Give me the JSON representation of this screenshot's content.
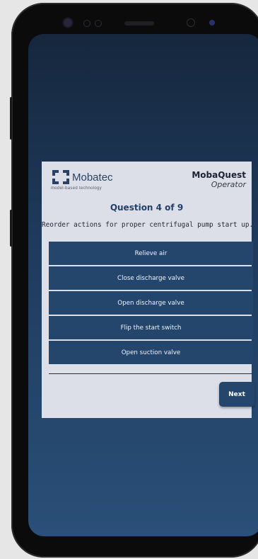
{
  "app": {
    "logo_name": "Mobatec",
    "logo_tagline": "model-based technology",
    "brand_title": "MobaQuest",
    "brand_subtitle": "Operator"
  },
  "question": {
    "number_label": "Question 4 of 9",
    "prompt": "Reorder actions for proper centrifugal pump start up."
  },
  "options": [
    "Relieve air",
    "Close discharge valve",
    "Open discharge valve",
    "Flip the start switch",
    "Open suction valve"
  ],
  "actions": {
    "next_label": "Next"
  },
  "colors": {
    "accent": "#24466c",
    "card_background": "#dcdfe8",
    "screen_background": "#1f3c5f"
  }
}
